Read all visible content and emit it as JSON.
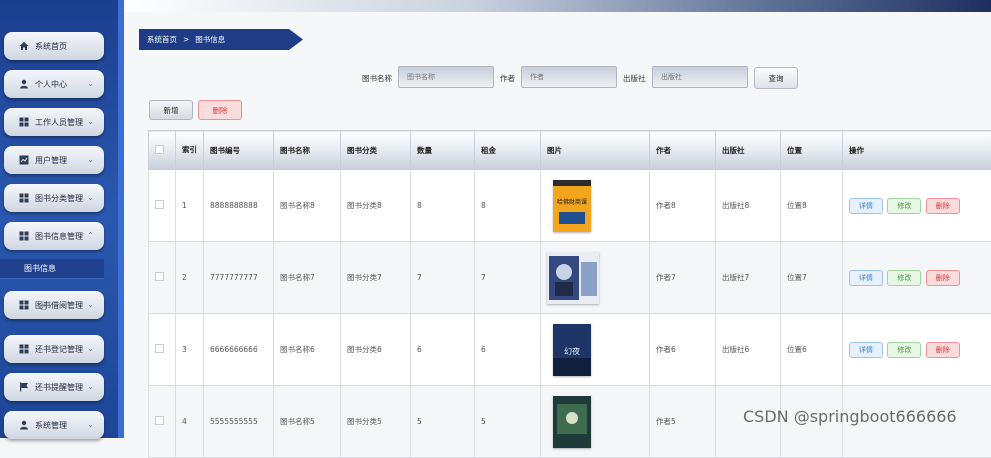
{
  "sidebar": {
    "items": [
      {
        "label": "系统首页",
        "icon": "home-icon"
      },
      {
        "label": "个人中心",
        "icon": "person-icon"
      },
      {
        "label": "工作人员管理",
        "icon": "grid-icon"
      },
      {
        "label": "用户管理",
        "icon": "board-icon"
      },
      {
        "label": "图书分类管理",
        "icon": "grid-icon"
      },
      {
        "label": "图书信息管理",
        "icon": "grid-icon"
      },
      {
        "label": "图书借阅管理",
        "icon": "grid-icon"
      },
      {
        "label": "还书登记管理",
        "icon": "grid-icon"
      },
      {
        "label": "还书提醒管理",
        "icon": "flag-icon"
      },
      {
        "label": "系统管理",
        "icon": "person-icon"
      }
    ],
    "active_sub": "图书信息"
  },
  "breadcrumb": {
    "home": "系统首页",
    "sep": ">",
    "current": "图书信息"
  },
  "search": {
    "name_label": "图书名称",
    "name_placeholder": "图书名称",
    "author_label": "作者",
    "author_placeholder": "作者",
    "publisher_label": "出版社",
    "publisher_placeholder": "出版社",
    "button": "查询"
  },
  "toolbar": {
    "add": "新增",
    "delete": "删除"
  },
  "table": {
    "headers": [
      "索引",
      "图书编号",
      "图书名称",
      "图书分类",
      "数量",
      "租金",
      "图片",
      "作者",
      "出版社",
      "位置",
      "操作"
    ],
    "rows": [
      {
        "idx": "1",
        "code": "8888888888",
        "name": "图书名称8",
        "cat": "图书分类8",
        "qty": "8",
        "rent": "8",
        "author": "作者8",
        "pub": "出版社8",
        "loc": "位置8",
        "cover_text": "哈佛财商课",
        "cover_color": "#f0a020"
      },
      {
        "idx": "2",
        "code": "7777777777",
        "name": "图书名称7",
        "cat": "图书分类7",
        "qty": "7",
        "rent": "7",
        "author": "作者7",
        "pub": "出版社7",
        "loc": "位置7",
        "cover_text": "",
        "cover_color": "#3a4f8f"
      },
      {
        "idx": "3",
        "code": "6666666666",
        "name": "图书名称6",
        "cat": "图书分类6",
        "qty": "6",
        "rent": "6",
        "author": "作者6",
        "pub": "出版社6",
        "loc": "位置6",
        "cover_text": "幻夜",
        "cover_color": "#1e3a6e"
      },
      {
        "idx": "4",
        "code": "5555555555",
        "name": "图书名称5",
        "cat": "图书分类5",
        "qty": "5",
        "rent": "5",
        "author": "作者5",
        "pub": "",
        "loc": "",
        "cover_text": "",
        "cover_color": "#1f3a3a"
      }
    ],
    "actions": {
      "detail": "详情",
      "edit": "修改",
      "delete": "删除"
    }
  },
  "watermark": "CSDN @springboot666666"
}
